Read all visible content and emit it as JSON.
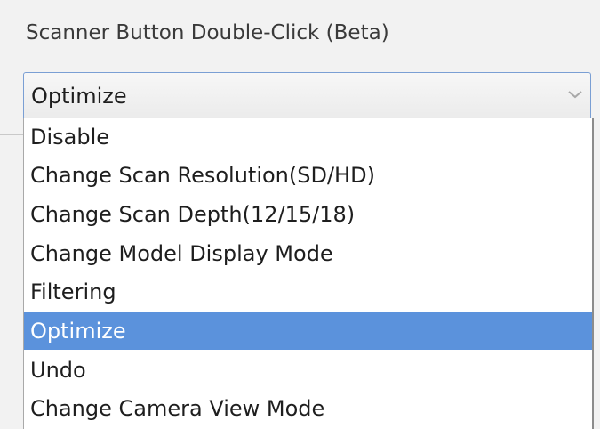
{
  "setting": {
    "label": "Scanner Button Double-Click (Beta)"
  },
  "combo": {
    "selected_value": "Optimize",
    "arrow_icon": "chevron-down-icon"
  },
  "dropdown": {
    "options": [
      {
        "label": "Disable"
      },
      {
        "label": "Change Scan Resolution(SD/HD)"
      },
      {
        "label": "Change Scan Depth(12/15/18)"
      },
      {
        "label": "Change Model Display Mode"
      },
      {
        "label": "Filtering"
      },
      {
        "label": "Optimize",
        "selected": true
      },
      {
        "label": "Undo"
      },
      {
        "label": "Change Camera View Mode"
      }
    ],
    "highlight_color": "#5b92dc"
  }
}
